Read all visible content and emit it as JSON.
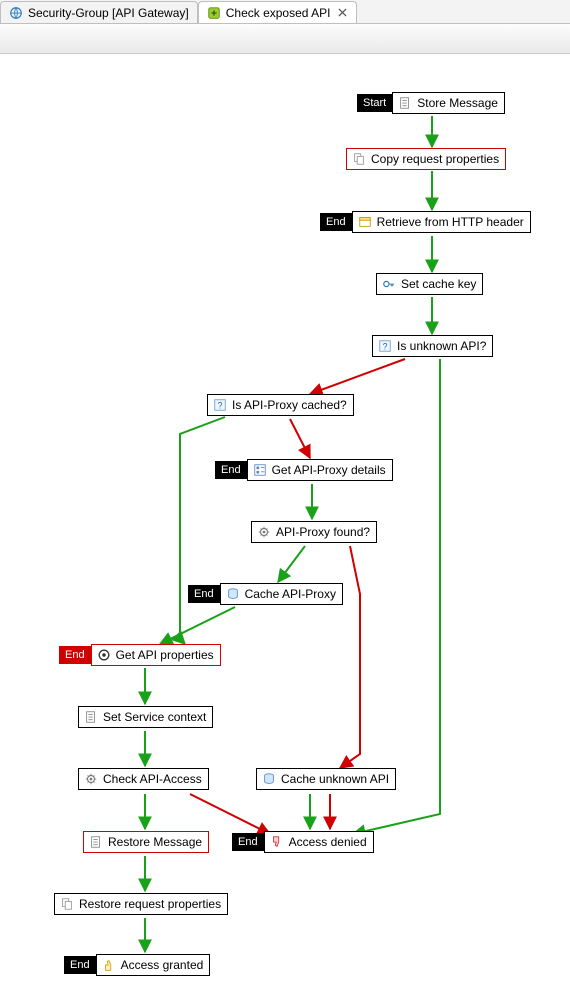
{
  "tabs": [
    {
      "label": "Security-Group [API Gateway]",
      "icon": "globe"
    },
    {
      "label": "Check exposed API",
      "icon": "policy",
      "active": true
    }
  ],
  "tags": {
    "start": "Start",
    "end": "End"
  },
  "nodes": {
    "store_message": {
      "label": "Store Message"
    },
    "copy_request_properties": {
      "label": "Copy request properties"
    },
    "retrieve_http_header": {
      "label": "Retrieve from HTTP header"
    },
    "set_cache_key": {
      "label": "Set cache key"
    },
    "is_unknown_api": {
      "label": "Is unknown API?"
    },
    "is_api_proxy_cached": {
      "label": "Is API-Proxy cached?"
    },
    "get_api_proxy_details": {
      "label": "Get API-Proxy details"
    },
    "api_proxy_found": {
      "label": "API-Proxy found?"
    },
    "cache_api_proxy": {
      "label": "Cache API-Proxy"
    },
    "get_api_properties": {
      "label": "Get API properties"
    },
    "set_service_context": {
      "label": "Set Service context"
    },
    "check_api_access": {
      "label": "Check API-Access"
    },
    "cache_unknown_api": {
      "label": "Cache unknown API"
    },
    "restore_message": {
      "label": "Restore Message"
    },
    "access_denied": {
      "label": "Access denied"
    },
    "restore_request_properties": {
      "label": "Restore request properties"
    },
    "access_granted": {
      "label": "Access granted"
    }
  },
  "edges": [
    {
      "from": "store_message",
      "to": "copy_request_properties",
      "kind": "success"
    },
    {
      "from": "copy_request_properties",
      "to": "retrieve_http_header",
      "kind": "success"
    },
    {
      "from": "retrieve_http_header",
      "to": "set_cache_key",
      "kind": "success"
    },
    {
      "from": "set_cache_key",
      "to": "is_unknown_api",
      "kind": "success"
    },
    {
      "from": "is_unknown_api",
      "to": "is_api_proxy_cached",
      "kind": "failure"
    },
    {
      "from": "is_unknown_api",
      "to": "access_denied",
      "kind": "success"
    },
    {
      "from": "is_api_proxy_cached",
      "to": "get_api_properties",
      "kind": "success"
    },
    {
      "from": "is_api_proxy_cached",
      "to": "get_api_proxy_details",
      "kind": "failure"
    },
    {
      "from": "get_api_proxy_details",
      "to": "api_proxy_found",
      "kind": "success"
    },
    {
      "from": "api_proxy_found",
      "to": "cache_api_proxy",
      "kind": "success"
    },
    {
      "from": "api_proxy_found",
      "to": "cache_unknown_api",
      "kind": "failure"
    },
    {
      "from": "cache_api_proxy",
      "to": "get_api_properties",
      "kind": "success"
    },
    {
      "from": "get_api_properties",
      "to": "set_service_context",
      "kind": "success"
    },
    {
      "from": "set_service_context",
      "to": "check_api_access",
      "kind": "success"
    },
    {
      "from": "check_api_access",
      "to": "restore_message",
      "kind": "success"
    },
    {
      "from": "check_api_access",
      "to": "access_denied",
      "kind": "failure"
    },
    {
      "from": "cache_unknown_api",
      "to": "access_denied",
      "kind": "success"
    },
    {
      "from": "cache_unknown_api",
      "to": "access_denied",
      "kind": "failure"
    },
    {
      "from": "restore_message",
      "to": "restore_request_properties",
      "kind": "success"
    },
    {
      "from": "restore_request_properties",
      "to": "access_granted",
      "kind": "success"
    }
  ],
  "colors": {
    "success": "#1aa11a",
    "failure": "#d10000",
    "black": "#000000"
  }
}
